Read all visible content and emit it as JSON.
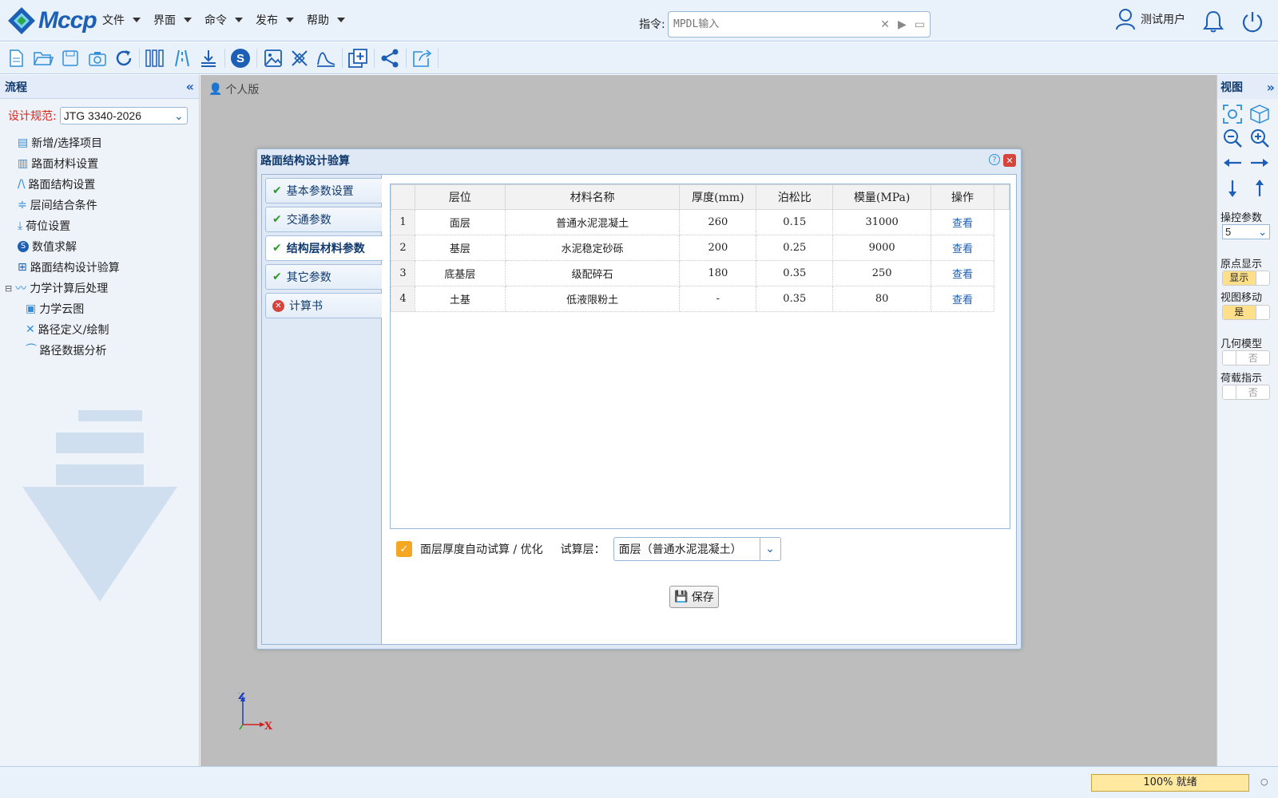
{
  "app": {
    "logo_text": "Mccp",
    "accent": "#1d5fb4"
  },
  "menu": [
    "文件",
    "界面",
    "命令",
    "发布",
    "帮助"
  ],
  "command": {
    "label": "指令:",
    "placeholder": "MPDL输入"
  },
  "user": {
    "name": "测试用户"
  },
  "toolbar_icons": [
    "new-file-icon",
    "open-folder-icon",
    "save-icon",
    "camera-icon",
    "refresh-icon",
    "material-icon",
    "structure-icon",
    "load-icon",
    "solver-icon",
    "image-icon",
    "path-icon",
    "chart-icon",
    "check-design-icon",
    "share-icon",
    "export-icon"
  ],
  "left_panel": {
    "title": "流程",
    "spec_label": "设计规范:",
    "spec_value": "JTG 3340-2026",
    "tree": [
      "新增/选择项目",
      "路面材料设置",
      "路面结构设置",
      "层间结合条件",
      "荷位设置",
      "数值求解",
      "路面结构设计验算",
      "力学计算后处理",
      "力学云图",
      "路径定义/绘制",
      "路径数据分析"
    ]
  },
  "canvas": {
    "breadcrumb": "个人版"
  },
  "dialog": {
    "title": "路面结构设计验算",
    "tabs": [
      "基本参数设置",
      "交通参数",
      "结构层材料参数",
      "其它参数",
      "计算书"
    ],
    "table": {
      "headers": [
        "层位",
        "材料名称",
        "厚度(mm)",
        "泊松比",
        "模量(MPa)",
        "操作"
      ],
      "rows": [
        [
          "1",
          "面层",
          "普通水泥混凝土",
          "260",
          "0.15",
          "31000",
          "查看"
        ],
        [
          "2",
          "基层",
          "水泥稳定砂砾",
          "200",
          "0.25",
          "9000",
          "查看"
        ],
        [
          "3",
          "底基层",
          "级配碎石",
          "180",
          "0.35",
          "250",
          "查看"
        ],
        [
          "4",
          "土基",
          "低液限粉土",
          "-",
          "0.35",
          "80",
          "查看"
        ]
      ]
    },
    "auto_optimize_label": "面层厚度自动试算 / 优化",
    "trial_layer_label": "试算层：",
    "trial_layer_value": "面层（普通水泥混凝土）",
    "save_label": "保存"
  },
  "right_panel": {
    "title": "视图",
    "ctrl_param_label": "操控参数",
    "ctrl_param_value": "5",
    "origin_label": "原点显示",
    "origin_value": "显示",
    "viewmove_label": "视图移动",
    "viewmove_value": "是",
    "geom_label": "几何模型",
    "geom_value": "否",
    "load_label": "荷载指示",
    "load_value": "否"
  },
  "axis": {
    "z": "Z",
    "x": "X"
  },
  "status": {
    "progress_text": "100% 就绪",
    "progress": 1.0
  }
}
